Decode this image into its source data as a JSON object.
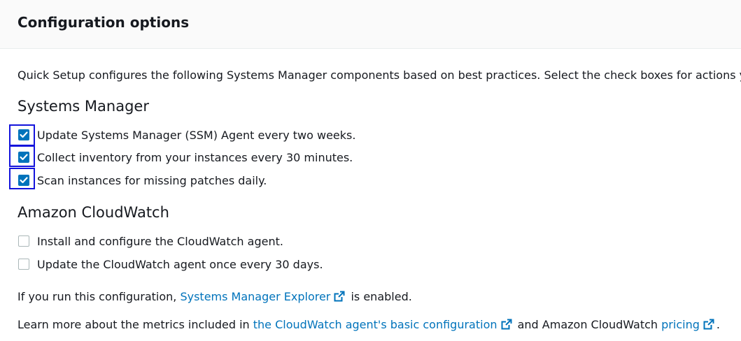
{
  "header": {
    "title": "Configuration options"
  },
  "intro": "Quick Setup configures the following Systems Manager components based on best practices. Select the check boxes for actions you",
  "systems_manager": {
    "title": "Systems Manager",
    "options": [
      {
        "label": "Update Systems Manager (SSM) Agent every two weeks.",
        "checked": true
      },
      {
        "label": "Collect inventory from your instances every 30 minutes.",
        "checked": true
      },
      {
        "label": "Scan instances for missing patches daily.",
        "checked": true
      }
    ]
  },
  "cloudwatch": {
    "title": "Amazon CloudWatch",
    "options": [
      {
        "label": "Install and configure the CloudWatch agent.",
        "checked": false
      },
      {
        "label": "Update the CloudWatch agent once every 30 days.",
        "checked": false
      }
    ]
  },
  "explorer_note": {
    "prefix": "If you run this configuration, ",
    "link": "Systems Manager Explorer",
    "suffix": " is enabled."
  },
  "learn_more": {
    "prefix": "Learn more about the metrics included in ",
    "link1": "the CloudWatch agent's basic configuration",
    "middle": " and Amazon CloudWatch ",
    "link2": "pricing",
    "suffix": "."
  },
  "colors": {
    "link": "#0073bb",
    "checkbox_checked": "#0073bb",
    "highlight": "#1414dc"
  },
  "icons": {
    "external_link": "external-link-icon",
    "check": "check-icon"
  }
}
